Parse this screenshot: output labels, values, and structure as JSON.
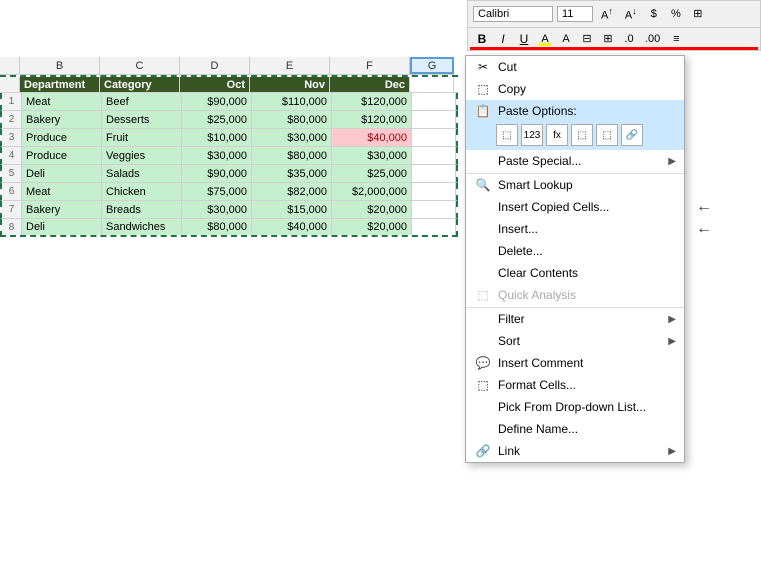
{
  "toolbar": {
    "font_name": "Calibri",
    "font_size": "11",
    "buttons_row1": [
      "A↑",
      "A↓",
      "$",
      "%",
      "⊞"
    ],
    "bold": "B",
    "italic": "I",
    "underline": "U",
    "highlight_label": "A",
    "format_label": "A"
  },
  "columns": {
    "row_num": "",
    "b": "B",
    "c": "C",
    "d": "D",
    "e": "E",
    "f": "F",
    "g": "G"
  },
  "headers": {
    "department": "Department",
    "category": "Category",
    "oct": "Oct",
    "nov": "Nov",
    "dec": "Dec"
  },
  "rows": [
    {
      "num": "1",
      "dept": "Meat",
      "cat": "Beef",
      "oct": "$90,000",
      "nov": "$110,000",
      "dec": "$120,000"
    },
    {
      "num": "2",
      "dept": "Bakery",
      "cat": "Desserts",
      "oct": "$25,000",
      "nov": "$80,000",
      "dec": "$120,000"
    },
    {
      "num": "3",
      "dept": "Produce",
      "cat": "Fruit",
      "oct": "$10,000",
      "nov": "$30,000",
      "dec": "$40,000"
    },
    {
      "num": "4",
      "dept": "Produce",
      "cat": "Veggies",
      "oct": "$30,000",
      "nov": "$80,000",
      "dec": "$30,000"
    },
    {
      "num": "5",
      "dept": "Deli",
      "cat": "Salads",
      "oct": "$90,000",
      "nov": "$35,000",
      "dec": "$25,000"
    },
    {
      "num": "6",
      "dept": "Meat",
      "cat": "Chicken",
      "oct": "$75,000",
      "nov": "$82,000",
      "dec": "$2,000,000"
    },
    {
      "num": "7",
      "dept": "Bakery",
      "cat": "Breads",
      "oct": "$30,000",
      "nov": "$15,000",
      "dec": "$20,000"
    },
    {
      "num": "8",
      "dept": "Deli",
      "cat": "Sandwiches",
      "oct": "$80,000",
      "nov": "$40,000",
      "dec": "$20,000"
    }
  ],
  "context_menu": {
    "items": [
      {
        "id": "cut",
        "label": "Cut",
        "icon": "✂",
        "has_arrow": false,
        "disabled": false,
        "separator_before": false
      },
      {
        "id": "copy",
        "label": "Copy",
        "icon": "⬜",
        "has_arrow": false,
        "disabled": false,
        "separator_before": false
      },
      {
        "id": "paste-options",
        "label": "Paste Options:",
        "icon": "📋",
        "has_arrow": false,
        "disabled": false,
        "separator_before": false
      },
      {
        "id": "paste-special",
        "label": "Paste Special...",
        "icon": "",
        "has_arrow": true,
        "disabled": false,
        "separator_before": false
      },
      {
        "id": "smart-lookup",
        "label": "Smart Lookup",
        "icon": "🔍",
        "has_arrow": false,
        "disabled": false,
        "separator_before": true
      },
      {
        "id": "insert-copied",
        "label": "Insert Copied Cells...",
        "icon": "",
        "has_arrow": false,
        "disabled": false,
        "separator_before": false,
        "has_right_arrow": true
      },
      {
        "id": "insert",
        "label": "Insert...",
        "icon": "",
        "has_arrow": false,
        "disabled": false,
        "separator_before": false,
        "has_right_arrow": true
      },
      {
        "id": "delete",
        "label": "Delete...",
        "icon": "",
        "has_arrow": false,
        "disabled": false,
        "separator_before": false
      },
      {
        "id": "clear-contents",
        "label": "Clear Contents",
        "icon": "",
        "has_arrow": false,
        "disabled": false,
        "separator_before": false
      },
      {
        "id": "quick-analysis",
        "label": "Quick Analysis",
        "icon": "⬜",
        "has_arrow": false,
        "disabled": true,
        "separator_before": false
      },
      {
        "id": "filter",
        "label": "Filter",
        "icon": "",
        "has_arrow": true,
        "disabled": false,
        "separator_before": true
      },
      {
        "id": "sort",
        "label": "Sort",
        "icon": "",
        "has_arrow": true,
        "disabled": false,
        "separator_before": false
      },
      {
        "id": "insert-comment",
        "label": "Insert Comment",
        "icon": "💬",
        "has_arrow": false,
        "disabled": false,
        "separator_before": false
      },
      {
        "id": "format-cells",
        "label": "Format Cells...",
        "icon": "⬜",
        "has_arrow": false,
        "disabled": false,
        "separator_before": false
      },
      {
        "id": "pick-from-dropdown",
        "label": "Pick From Drop-down List...",
        "icon": "",
        "has_arrow": false,
        "disabled": false,
        "separator_before": false
      },
      {
        "id": "define-name",
        "label": "Define Name...",
        "icon": "",
        "has_arrow": false,
        "disabled": false,
        "separator_before": false
      },
      {
        "id": "link",
        "label": "Link",
        "icon": "🔗",
        "has_arrow": true,
        "disabled": false,
        "separator_before": false
      }
    ]
  }
}
